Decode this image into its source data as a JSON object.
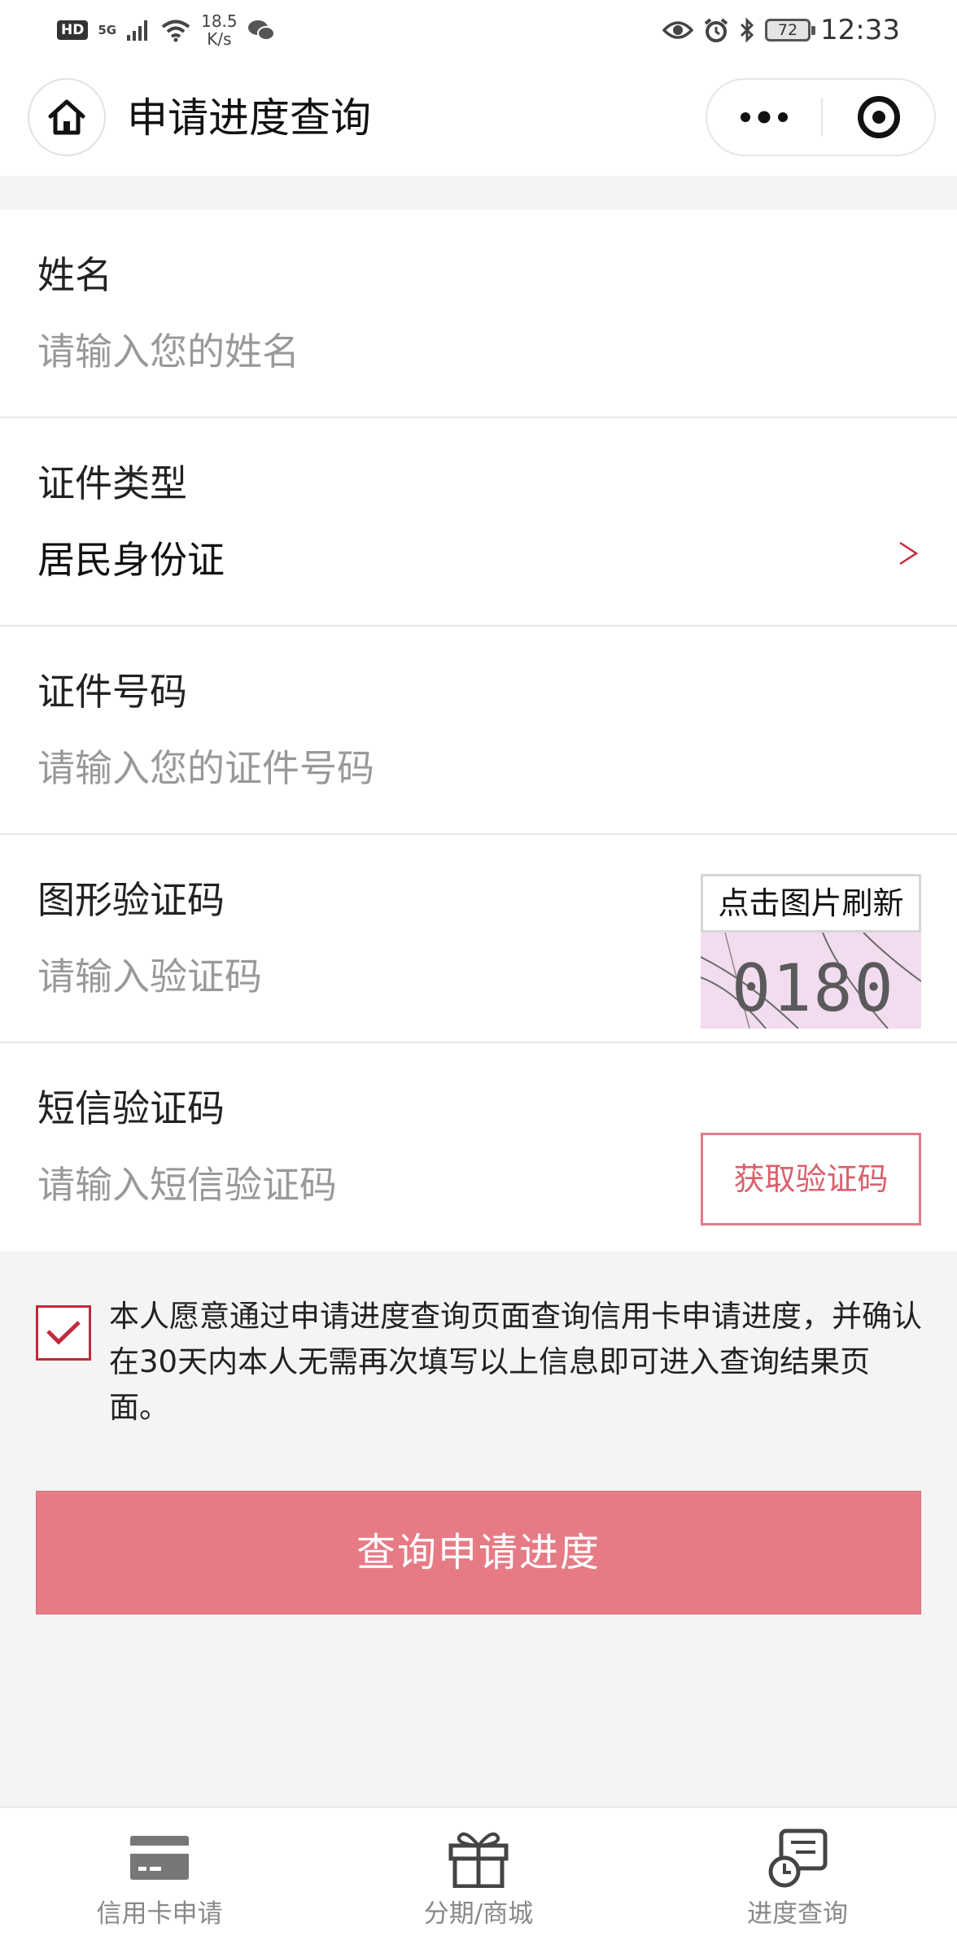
{
  "status_bar": {
    "hd": "HD",
    "network": "5G",
    "speed_value": "18.5",
    "speed_unit": "K/s",
    "battery": "72",
    "time": "12:33",
    "icons": [
      "signal-icon",
      "wifi-icon",
      "wechat-icon",
      "eye-icon",
      "alarm-icon",
      "bluetooth-icon",
      "battery-icon"
    ]
  },
  "nav": {
    "title": "申请进度查询",
    "home_icon": "home-icon",
    "more_icon": "more-dots-icon",
    "close_icon": "close-target-icon"
  },
  "form": {
    "name": {
      "label": "姓名",
      "placeholder": "请输入您的姓名",
      "value": ""
    },
    "id_type": {
      "label": "证件类型",
      "value": "居民身份证",
      "icon": "chevron-right-icon"
    },
    "id_number": {
      "label": "证件号码",
      "placeholder": "请输入您的证件号码",
      "value": ""
    },
    "captcha": {
      "label": "图形验证码",
      "placeholder": "请输入验证码",
      "refresh_label": "点击图片刷新",
      "image_text": "0180"
    },
    "sms": {
      "label": "短信验证码",
      "placeholder": "请输入短信验证码",
      "button_label": "获取验证码"
    }
  },
  "agreement": {
    "checked": true,
    "text": "本人愿意通过申请进度查询页面查询信用卡申请进度，并确认在30天内本人无需再次填写以上信息即可进入查询结果页面。"
  },
  "submit": {
    "label": "查询申请进度"
  },
  "tabbar": [
    {
      "label": "信用卡申请",
      "icon": "credit-card-icon"
    },
    {
      "label": "分期/商城",
      "icon": "gift-icon"
    },
    {
      "label": "进度查询",
      "icon": "progress-clock-icon"
    }
  ],
  "colors": {
    "accent": "#c2293c",
    "button": "#e67b86",
    "sms_button_text": "#d9606d",
    "background": "#f4f4f4"
  }
}
